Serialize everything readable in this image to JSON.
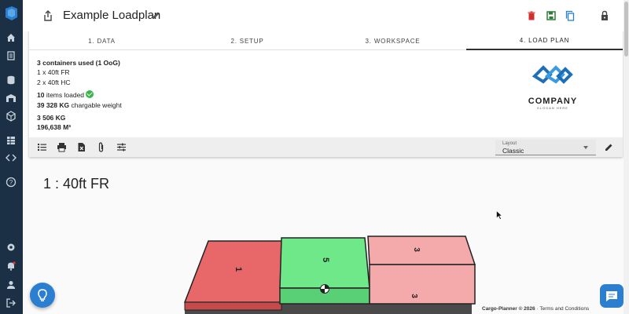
{
  "header": {
    "title": "Example Loadplan"
  },
  "tabs": [
    {
      "label": "1. DATA"
    },
    {
      "label": "2. SETUP"
    },
    {
      "label": "3. WORKSPACE"
    },
    {
      "label": "4. LOAD PLAN"
    }
  ],
  "summary": {
    "containers_used": "3 containers used (1 OoG)",
    "container_line_1": "1 x 40ft FR",
    "container_line_2": "2 x 40ft HC",
    "items_count": "10",
    "items_text": " items loaded",
    "chargeable_weight_value": "39 328 KG",
    "chargeable_weight_text": " chargable weight",
    "weight": "3 506 KG",
    "volume": "196,638 M³"
  },
  "company_logo": {
    "name": "COMPANY",
    "slogan": "SLOGAN HERE"
  },
  "layout_select": {
    "label": "Layout",
    "value": "Classic"
  },
  "container": {
    "title": "1 : 40ft FR"
  },
  "cargo_labels": {
    "red": "1",
    "green": "5",
    "pink_top": "3",
    "pink_front": "3"
  },
  "footer": {
    "brand": "Cargo-Planner © 2026",
    "link": "Terms and Conditions"
  },
  "colors": {
    "sidebar": "#1b2f45",
    "accent": "#2b7fd0",
    "cargo_red": "#e8686a",
    "cargo_green": "#6ee889",
    "cargo_pink": "#f4a9ab",
    "delete": "#d32f2f",
    "save": "#2e7d32"
  }
}
